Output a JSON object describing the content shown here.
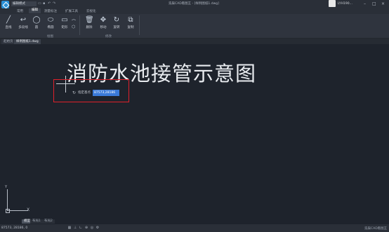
{
  "titlebar": {
    "mode": "编辑模式",
    "title": "浩辰CAD看图王 - [样例图纸1.dwg]",
    "username": "LYH190...",
    "quick_icons": [
      "open-icon",
      "save-icon",
      "undo-icon",
      "redo-icon"
    ]
  },
  "menu": {
    "items": [
      "常用",
      "编辑",
      "测量标注",
      "扩展工具",
      "云视化"
    ]
  },
  "ribbon": {
    "tools": [
      "直线",
      "多段线",
      "圆",
      "椭圆",
      "矩形",
      "删除",
      "移动",
      "旋转",
      "复制"
    ],
    "groups": [
      "绘图",
      "修改"
    ]
  },
  "tabs": {
    "items": [
      "起始页",
      "样例图纸1.dwg"
    ]
  },
  "canvas": {
    "drawing_text": "消防水池接管示意图",
    "prompt_label": "指定基点",
    "prompt_value": "87573,28186",
    "ucs_y": "Y",
    "ucs_x": "X"
  },
  "layout_tabs": [
    "模型",
    "布局1",
    "布局2"
  ],
  "status": {
    "coords": "87573, 28186, 0",
    "brand": "浩辰CAD看图王"
  },
  "colors": {
    "canvas_bg": "#1e232c",
    "accent": "#2a8fd6",
    "highlight_box": "#e0202a",
    "input_selected": "#3b7ad9"
  }
}
